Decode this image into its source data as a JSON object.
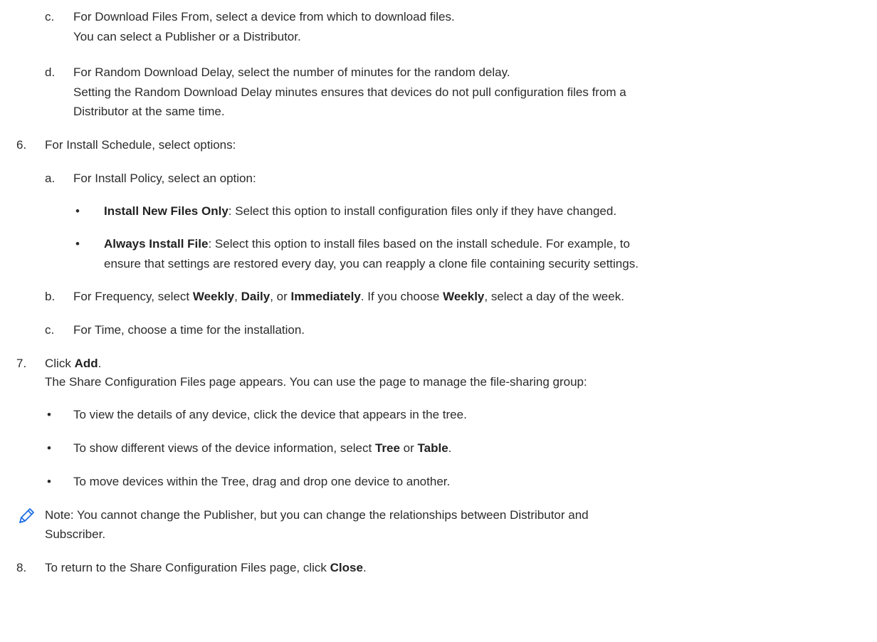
{
  "doc": {
    "step5c": {
      "marker": "c.",
      "line1": "For Download Files From, select a device from which to download files.",
      "line2": "You can select a Publisher or a Distributor."
    },
    "step5d": {
      "marker": "d.",
      "line1": "For Random Download Delay, select the number of minutes for the random delay.",
      "line2": "Setting the Random Download Delay minutes ensures that devices do not pull configuration files from a",
      "line3": "Distributor at the same time."
    },
    "step6": {
      "marker": "6.",
      "text": "For Install Schedule, select options:",
      "a": {
        "marker": "a.",
        "text": "For Install Policy, select an option:",
        "bullet1": {
          "bold": "Install New Files Only",
          "rest": ": Select this option to install configuration files only if they have changed."
        },
        "bullet2": {
          "bold": "Always Install File",
          "rest": ": Select this option to install files based on the install schedule. For example, to",
          "line2": "ensure that settings are restored every day, you can reapply a clone file containing security settings."
        }
      },
      "b": {
        "marker": "b.",
        "t1": "For Frequency, select ",
        "b1": "Weekly",
        "t2": ", ",
        "b2": "Daily",
        "t3": ", or ",
        "b3": "Immediately",
        "t4": ". If you choose ",
        "b4": "Weekly",
        "t5": ", select a day of the week."
      },
      "c": {
        "marker": "c.",
        "text": "For Time, choose a time for the installation."
      }
    },
    "step7": {
      "marker": "7.",
      "t1": "Click ",
      "b1": "Add",
      "t2": ".",
      "line2": "The Share Configuration Files page appears. You can use the page to manage the file-sharing group:",
      "bullet1": "To view the details of any device, click the device that appears in the tree.",
      "bullet2": {
        "t1": "To show different views of the device information, select ",
        "b1": "Tree",
        "t2": " or ",
        "b2": "Table",
        "t3": "."
      },
      "bullet3": "To move devices within the Tree, drag and drop one device to another.",
      "note": {
        "icon": "pencil-icon",
        "line1": "Note: You cannot change the Publisher, but you can change the relationships between Distributor and",
        "line2": "Subscriber."
      }
    },
    "step8": {
      "marker": "8.",
      "t1": "To return to the Share Configuration Files page, click ",
      "b1": "Close",
      "t2": "."
    },
    "bullet_char": "•",
    "accent_color": "#1f6fe5"
  }
}
